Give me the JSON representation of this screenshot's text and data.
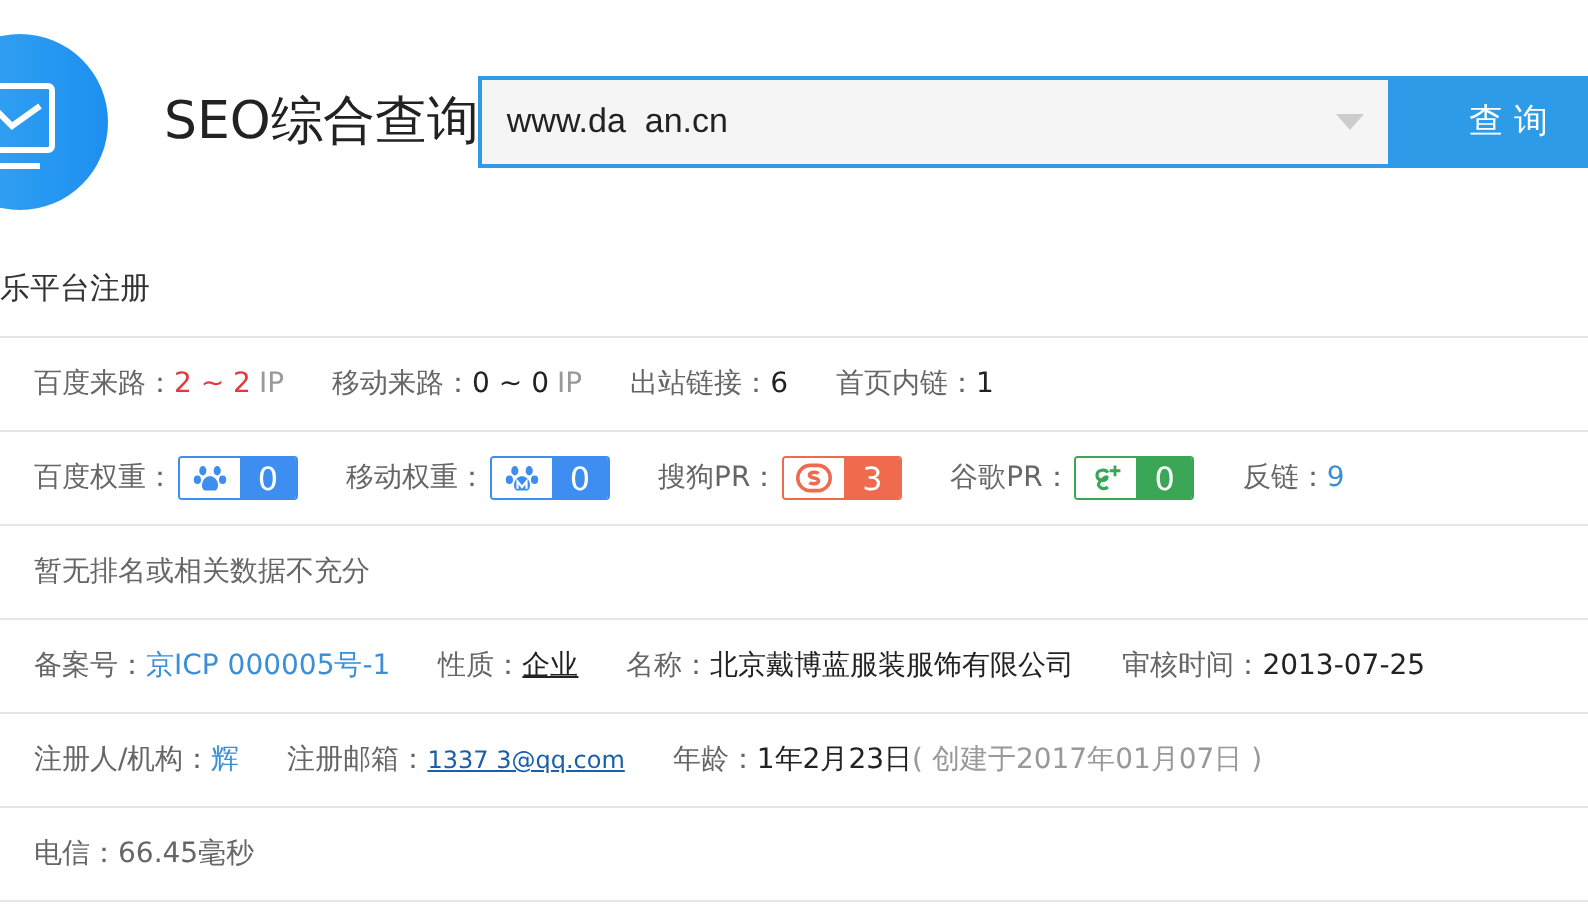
{
  "header": {
    "title": "SEO综合查询",
    "search": {
      "value": "www.da  an.cn"
    },
    "button": "查 询"
  },
  "subtitle": "乐平台注册",
  "rows": [
    {
      "items": [
        {
          "kind": "traffic",
          "label": "百度来路：",
          "value": "2 ~ 2",
          "unit": "IP",
          "alert": true
        },
        {
          "kind": "traffic",
          "label": "移动来路：",
          "value": "0 ~ 0",
          "unit": "IP",
          "alert": false
        },
        {
          "kind": "plain",
          "label": "出站链接：",
          "value": "6"
        },
        {
          "kind": "plain",
          "label": "首页内链：",
          "value": "1"
        }
      ]
    },
    {
      "items": [
        {
          "kind": "badge",
          "label": "百度权重：",
          "value": "0",
          "color": "#3d8ef0"
        },
        {
          "kind": "badge",
          "label": "移动权重：",
          "value": "0",
          "color": "#3d8ef0"
        },
        {
          "kind": "badge",
          "label": "搜狗PR：",
          "value": "3",
          "color": "#f06a4d"
        },
        {
          "kind": "badge",
          "label": "谷歌PR：",
          "value": "0",
          "color": "#3aa757"
        },
        {
          "kind": "link",
          "label": "反链：",
          "value": "9"
        }
      ]
    },
    {
      "items": [
        {
          "kind": "note",
          "value": "暂无排名或相关数据不充分"
        }
      ]
    },
    {
      "items": [
        {
          "kind": "link",
          "label": "备案号：",
          "value": "京ICP   000005号-1"
        },
        {
          "kind": "plain",
          "label": "性质：",
          "value": "企业",
          "underline": true
        },
        {
          "kind": "plain",
          "label": "名称：",
          "value": "北京戴博蓝服装服饰有限公司"
        },
        {
          "kind": "plain",
          "label": "审核时间：",
          "value": "2013-07-25"
        }
      ]
    },
    {
      "items": [
        {
          "kind": "link",
          "label": "注册人/机构：",
          "value": "辉"
        },
        {
          "kind": "email",
          "label": "注册邮箱：",
          "value": "1337   3@qq.com"
        },
        {
          "kind": "age",
          "label": "年龄：",
          "value": "1年2月23日",
          "extra": "( 创建于2017年01月07日 )"
        }
      ]
    },
    {
      "items": [
        {
          "kind": "note",
          "value": "电信：66.45毫秒"
        }
      ]
    }
  ]
}
